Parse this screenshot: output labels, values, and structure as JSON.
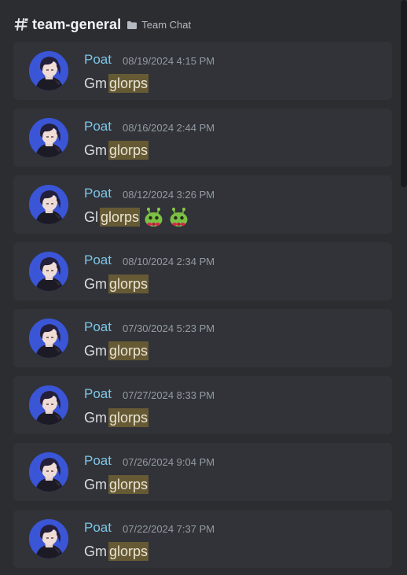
{
  "header": {
    "channel_name": "team-general",
    "category": "Team Chat"
  },
  "messages": [
    {
      "author": "Poat",
      "timestamp": "08/19/2024 4:15 PM",
      "prefix": "Gm",
      "highlight": "glorps",
      "emojis": []
    },
    {
      "author": "Poat",
      "timestamp": "08/16/2024 2:44 PM",
      "prefix": "Gm",
      "highlight": "glorps",
      "emojis": []
    },
    {
      "author": "Poat",
      "timestamp": "08/12/2024 3:26 PM",
      "prefix": "Gl",
      "highlight": "glorps",
      "emojis": [
        "glorp-emoji",
        "glorp-emoji"
      ]
    },
    {
      "author": "Poat",
      "timestamp": "08/10/2024 2:34 PM",
      "prefix": "Gm",
      "highlight": "glorps",
      "emojis": []
    },
    {
      "author": "Poat",
      "timestamp": "07/30/2024 5:23 PM",
      "prefix": "Gm",
      "highlight": "glorps",
      "emojis": []
    },
    {
      "author": "Poat",
      "timestamp": "07/27/2024 8:33 PM",
      "prefix": "Gm",
      "highlight": "glorps",
      "emojis": []
    },
    {
      "author": "Poat",
      "timestamp": "07/26/2024 9:04 PM",
      "prefix": "Gm",
      "highlight": "glorps",
      "emojis": []
    },
    {
      "author": "Poat",
      "timestamp": "07/22/2024 7:37 PM",
      "prefix": "Gm",
      "highlight": "glorps",
      "emojis": []
    }
  ],
  "colors": {
    "background": "#2b2d31",
    "card": "#313338",
    "author": "#7ec6e8",
    "highlight": "#665a35",
    "timestamp": "#949ba4"
  }
}
